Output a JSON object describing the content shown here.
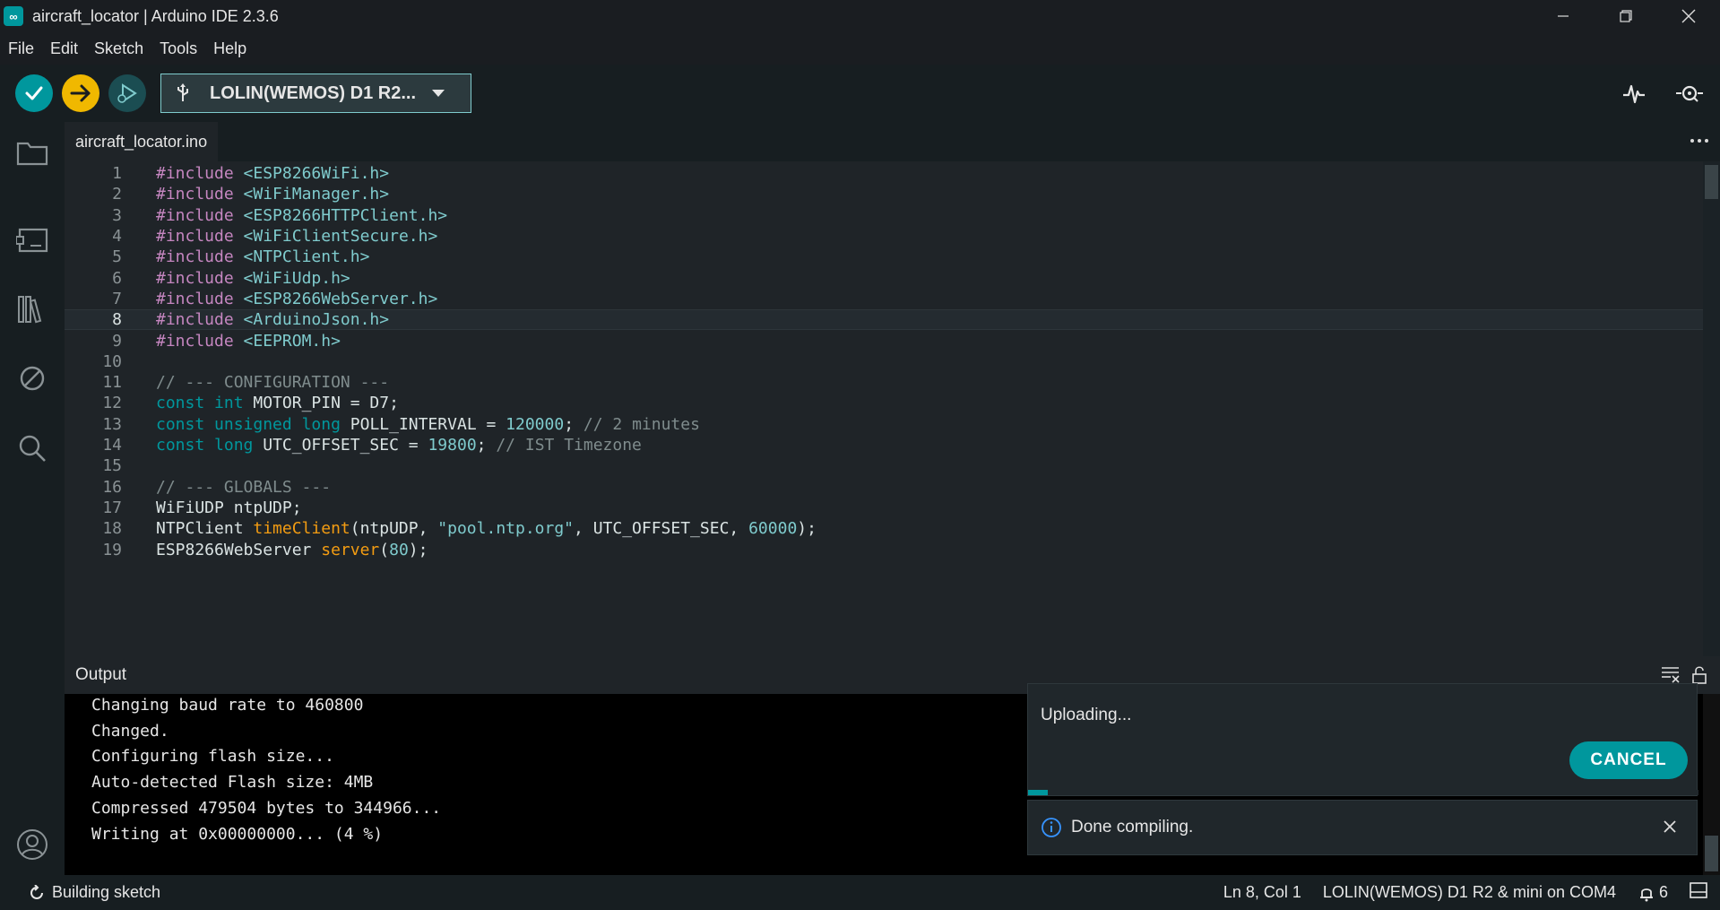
{
  "window": {
    "title": "aircraft_locator | Arduino IDE 2.3.6",
    "logo_glyph": "∞"
  },
  "menu": [
    "File",
    "Edit",
    "Sketch",
    "Tools",
    "Help"
  ],
  "toolbar": {
    "board_name": "LOLIN(WEMOS) D1 R2...",
    "verify_icon": "checkmark-icon",
    "upload_icon": "arrow-right-icon",
    "debug_icon": "debug-icon",
    "serial_plotter_icon": "serial-plotter-icon",
    "serial_monitor_icon": "serial-monitor-icon"
  },
  "editor": {
    "tab_label": "aircraft_locator.ino",
    "current_line": 8,
    "lines": [
      {
        "n": "1",
        "t": "#include <ESP8266WiFi.h>"
      },
      {
        "n": "2",
        "t": "#include <WiFiManager.h>"
      },
      {
        "n": "3",
        "t": "#include <ESP8266HTTPClient.h>"
      },
      {
        "n": "4",
        "t": "#include <WiFiClientSecure.h>"
      },
      {
        "n": "5",
        "t": "#include <NTPClient.h>"
      },
      {
        "n": "6",
        "t": "#include <WiFiUdp.h>"
      },
      {
        "n": "7",
        "t": "#include <ESP8266WebServer.h>"
      },
      {
        "n": "8",
        "t": "#include <ArduinoJson.h>"
      },
      {
        "n": "9",
        "t": "#include <EEPROM.h>"
      },
      {
        "n": "10",
        "t": ""
      },
      {
        "n": "11",
        "t": "// --- CONFIGURATION ---"
      },
      {
        "n": "12",
        "t": "const int MOTOR_PIN = D7;"
      },
      {
        "n": "13",
        "t": "const unsigned long POLL_INTERVAL = 120000; // 2 minutes"
      },
      {
        "n": "14",
        "t": "const long UTC_OFFSET_SEC = 19800; // IST Timezone"
      },
      {
        "n": "15",
        "t": ""
      },
      {
        "n": "16",
        "t": "// --- GLOBALS ---"
      },
      {
        "n": "17",
        "t": "WiFiUDP ntpUDP;"
      },
      {
        "n": "18",
        "t": "NTPClient timeClient(ntpUDP, \"pool.ntp.org\", UTC_OFFSET_SEC, 60000);"
      },
      {
        "n": "19",
        "t": "ESP8266WebServer server(80);"
      }
    ]
  },
  "output": {
    "title": "Output",
    "lines": [
      "Changing baud rate to 460800",
      "Changed.",
      "Configuring flash size...",
      "Auto-detected Flash size: 4MB",
      "Compressed 479504 bytes to 344966...",
      "Writing at 0x00000000... (4 %)"
    ]
  },
  "notifications": {
    "upload_text": "Uploading...",
    "cancel_label": "CANCEL",
    "upload_progress": 0.03,
    "done_text": "Done compiling."
  },
  "status": {
    "left": "Building sketch",
    "position": "Ln 8, Col 1",
    "board_port": "LOLIN(WEMOS) D1 R2 & mini on COM4",
    "notification_count": "6"
  },
  "colors": {
    "accent": "#00979d",
    "upload": "#f0b800",
    "background": "#1f2428"
  }
}
